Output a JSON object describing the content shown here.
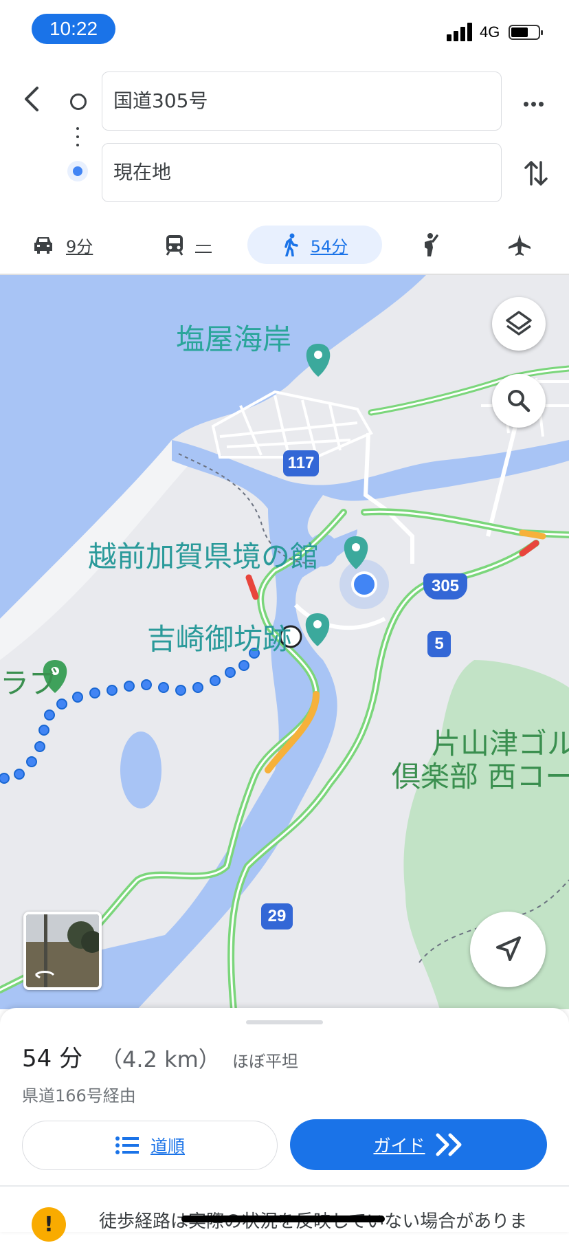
{
  "status_bar": {
    "time": "10:22",
    "network": "4G"
  },
  "route": {
    "origin": "国道305号",
    "destination": "現在地"
  },
  "modes": [
    {
      "name": "car",
      "value": "9分",
      "icon": "car-icon"
    },
    {
      "name": "transit",
      "value": "—",
      "icon": "train-icon"
    },
    {
      "name": "walk",
      "value": "54分",
      "icon": "walk-icon",
      "selected": true
    },
    {
      "name": "ride",
      "icon": "ride-hail-icon"
    },
    {
      "name": "flight",
      "icon": "airplane-icon"
    }
  ],
  "map": {
    "labels": {
      "beach": "塩屋海岸",
      "museum": "越前加賀県境の館",
      "ruins": "吉崎御坊跡",
      "golf_partial": "ラブ",
      "golf_line1": "片山津ゴル",
      "golf_line2": "倶楽部 西コー"
    },
    "route_shields": [
      "117",
      "305",
      "5",
      "29"
    ]
  },
  "summary": {
    "duration": "54 分",
    "distance": "（4.2 km）",
    "terrain": "ほぼ平坦",
    "via": "県道166号経由",
    "steps_label": "道順",
    "guide_label": "ガイド",
    "warning": "徒歩経路は実際の状況を反映していない場合がありま"
  },
  "colors": {
    "accent": "#1a73e8",
    "water": "#a8c4f5",
    "land": "#e9eaee",
    "traffic_green": "#7bd67b",
    "park": "#c2e3c6",
    "label_teal": "#2aa59a"
  }
}
